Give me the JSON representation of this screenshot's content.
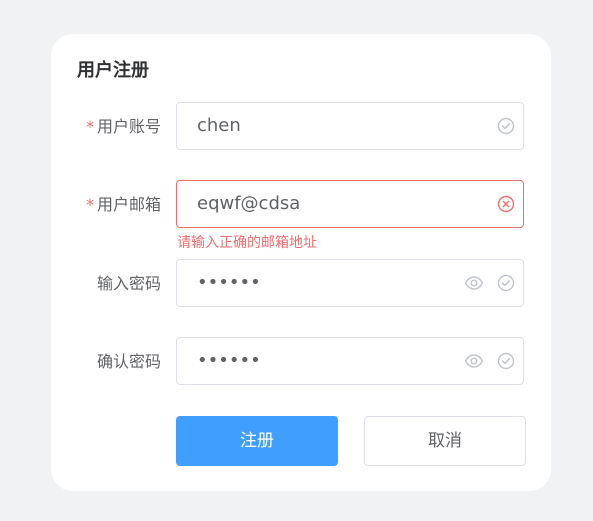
{
  "form": {
    "title": "用户注册",
    "required_mark": "*",
    "fields": [
      {
        "label": "用户账号",
        "value": "chen",
        "required": true,
        "status": "valid"
      },
      {
        "label": "用户邮箱",
        "value": "eqwf@cdsa",
        "required": true,
        "status": "error",
        "error": "请输入正确的邮箱地址"
      },
      {
        "label": "输入密码",
        "value": "••••••",
        "required": false,
        "status": "valid",
        "password": true
      },
      {
        "label": "确认密码",
        "value": "••••••",
        "required": false,
        "status": "valid",
        "password": true
      }
    ],
    "submit_label": "注册",
    "cancel_label": "取消"
  },
  "colors": {
    "primary": "#409eff",
    "error": "#f56c6c",
    "valid_icon": "#c0c4cc",
    "background": "#f0f2f4"
  },
  "icons": {
    "valid": "circle-check-icon",
    "error": "circle-close-icon",
    "password_toggle": "eye-icon"
  }
}
